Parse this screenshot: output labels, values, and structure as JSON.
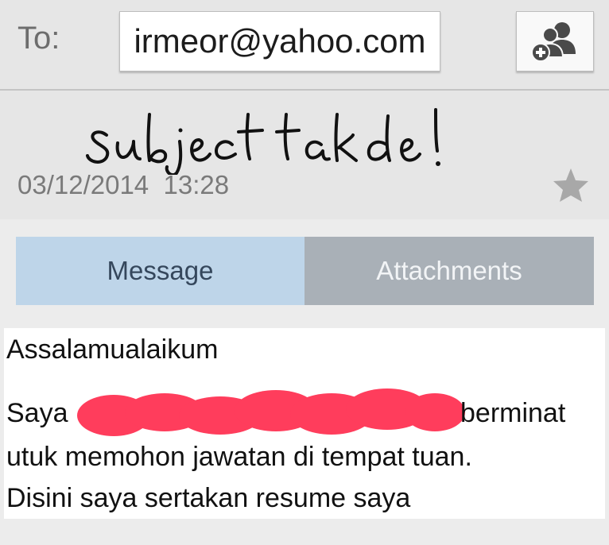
{
  "to_bar": {
    "label": "To:",
    "recipient": "irmeor@yahoo.com",
    "add_contact_icon": "add-contact-icon"
  },
  "subject": {
    "handwritten_text": "subject tak de!",
    "datetime": "03/12/2014  13:28",
    "star_icon": "star-icon"
  },
  "tabs": [
    {
      "label": "Message",
      "selected": true
    },
    {
      "label": "Attachments",
      "selected": false
    }
  ],
  "message_body": {
    "greeting": "Assalamualaikum",
    "line1_start": "Saya",
    "line1_end": "berminat",
    "line2": "utuk memohon jawatan di tempat tuan.",
    "line3": "Disini saya sertakan resume saya",
    "redaction_color": "#ff3d5c"
  },
  "colors": {
    "header_bg": "#e6e6e6",
    "tab_selected_bg": "#bed5e9",
    "tab_unselected_bg": "#a9b0b7"
  }
}
